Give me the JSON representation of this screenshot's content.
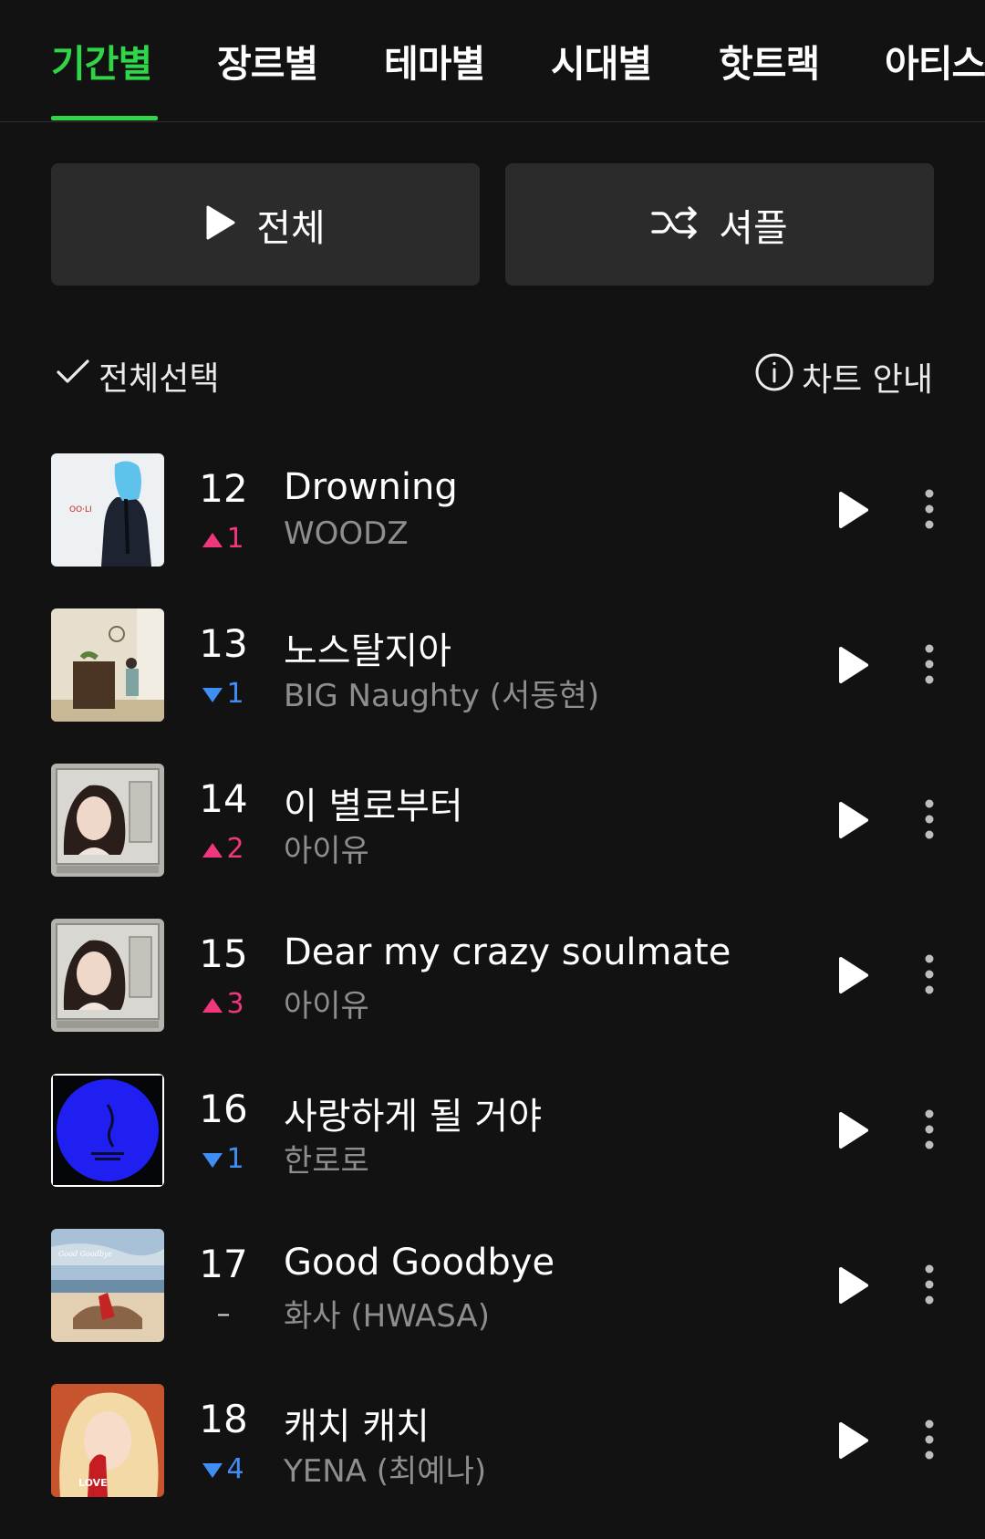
{
  "tabs": [
    {
      "label": "기간별",
      "active": true
    },
    {
      "label": "장르별",
      "active": false
    },
    {
      "label": "테마별",
      "active": false
    },
    {
      "label": "시대별",
      "active": false
    },
    {
      "label": "핫트랙",
      "active": false
    },
    {
      "label": "아티스",
      "active": false
    }
  ],
  "actions": {
    "play_all_label": "전체",
    "shuffle_label": "셔플",
    "play_icon": "play-icon",
    "shuffle_icon": "shuffle-icon"
  },
  "list_header": {
    "select_all_label": "전체선택",
    "chart_guide_label": "차트 안내"
  },
  "colors": {
    "accent": "#2ed648",
    "rank_up": "#f0367d",
    "rank_down": "#3f8ef4",
    "background": "#121212",
    "button_bg": "#2b2b2b"
  },
  "tracks": [
    {
      "rank": "12",
      "change": "1",
      "direction": "up",
      "title": "Drowning",
      "artist": "WOODZ"
    },
    {
      "rank": "13",
      "change": "1",
      "direction": "down",
      "title": "노스탈지아",
      "artist": "BIG Naughty (서동현)"
    },
    {
      "rank": "14",
      "change": "2",
      "direction": "up",
      "title": "이 별로부터",
      "artist": "아이유"
    },
    {
      "rank": "15",
      "change": "3",
      "direction": "up",
      "title": "Dear my crazy soulmate",
      "artist": "아이유"
    },
    {
      "rank": "16",
      "change": "1",
      "direction": "down",
      "title": "사랑하게 될 거야",
      "artist": "한로로"
    },
    {
      "rank": "17",
      "change": "–",
      "direction": "same",
      "title": "Good Goodbye",
      "artist": "화사 (HWASA)"
    },
    {
      "rank": "18",
      "change": "4",
      "direction": "down",
      "title": "캐치 캐치",
      "artist": "YENA (최예나)"
    }
  ]
}
